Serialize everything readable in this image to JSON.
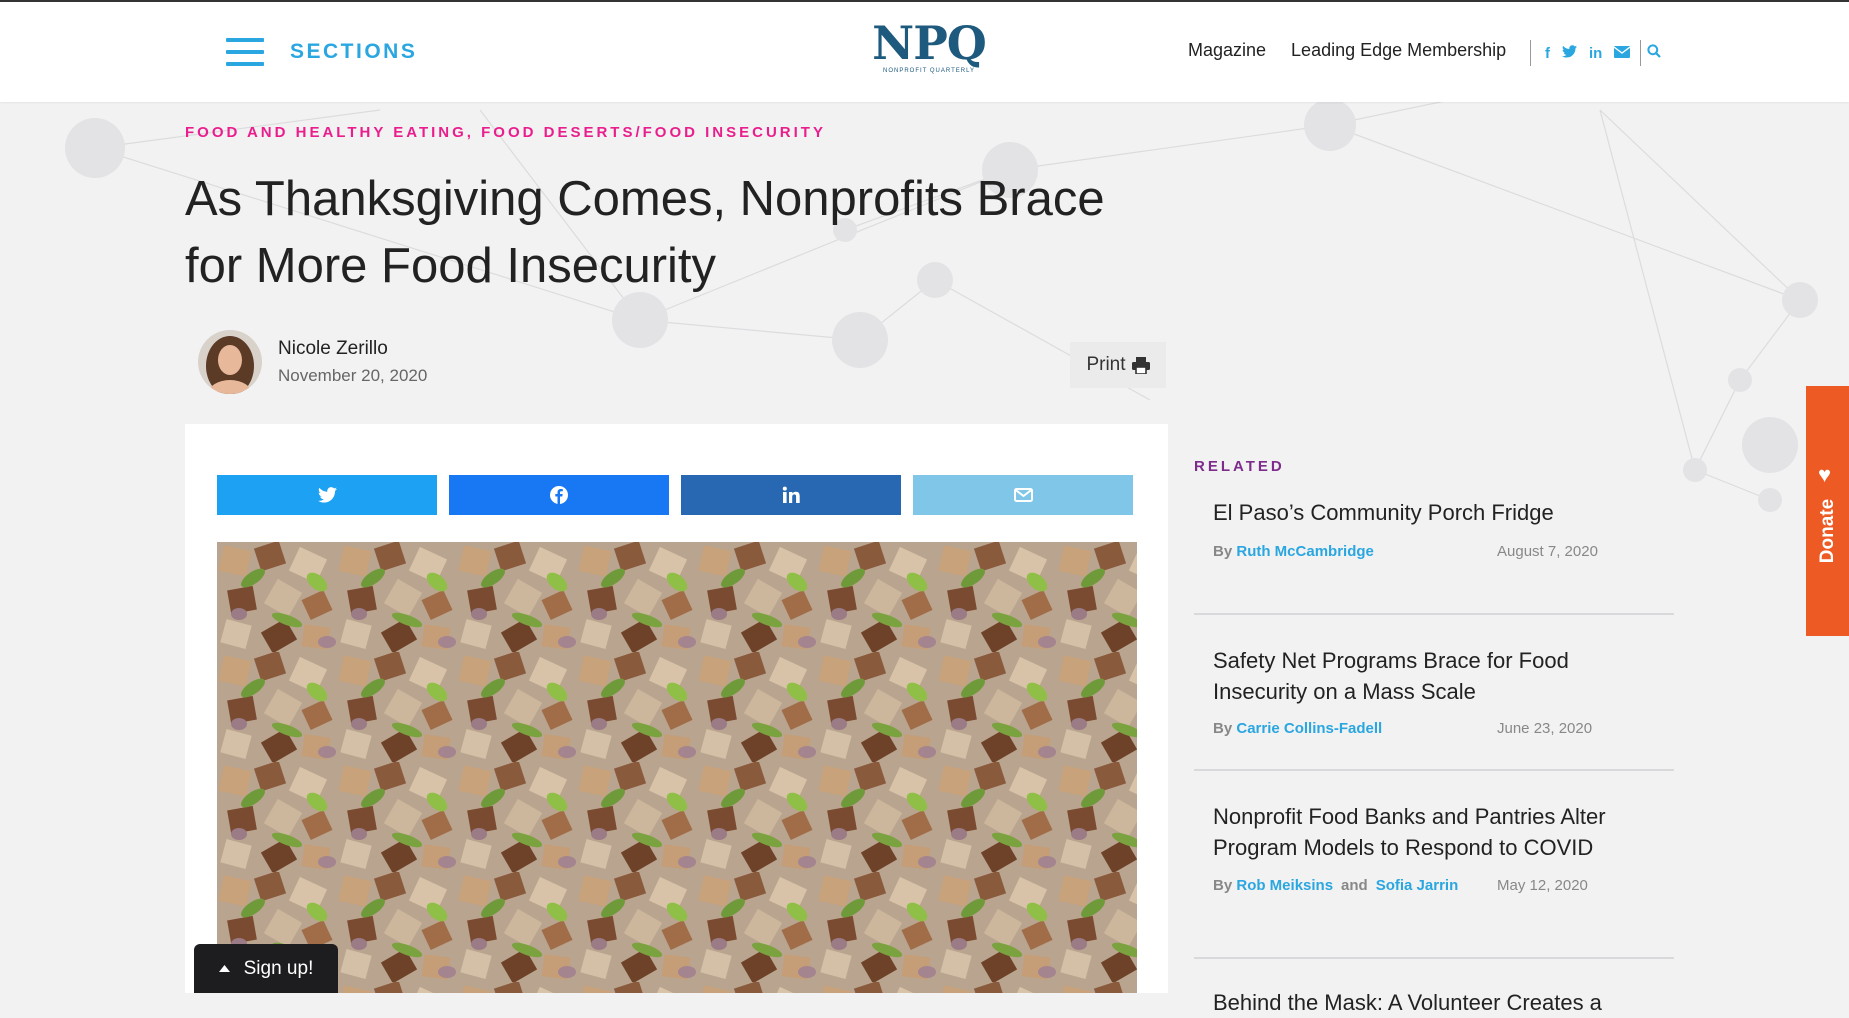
{
  "header": {
    "sections_label": "SECTIONS",
    "logo_text": "NPQ",
    "logo_subtext": "NONPROFIT QUARTERLY",
    "nav": [
      "Magazine",
      "Leading Edge Membership"
    ],
    "social_icons": [
      "facebook-icon",
      "twitter-icon",
      "linkedin-icon",
      "email-icon",
      "search-icon"
    ]
  },
  "article": {
    "category": "FOOD AND HEALTHY EATING, FOOD DESERTS/FOOD INSECURITY",
    "title": "As Thanksgiving Comes, Nonprofits Brace for More Food Insecurity",
    "author": "Nicole Zerillo",
    "date": "November 20, 2020",
    "print_label": "Print"
  },
  "share_buttons": [
    {
      "name": "twitter",
      "icon": "twitter-icon",
      "color": "#1da1f2"
    },
    {
      "name": "facebook",
      "icon": "facebook-icon",
      "color": "#1877f2"
    },
    {
      "name": "linkedin",
      "icon": "linkedin-icon",
      "color": "#2867b2"
    },
    {
      "name": "email",
      "icon": "email-icon",
      "color": "#7fc6e8"
    }
  ],
  "related": {
    "heading": "RELATED",
    "by_label": "By",
    "and_label": "and",
    "items": [
      {
        "title": "El Paso’s Community Porch Fridge",
        "authors": [
          "Ruth McCambridge"
        ],
        "date": "August 7, 2020"
      },
      {
        "title": "Safety Net Programs Brace for Food Insecurity on a Mass Scale",
        "authors": [
          "Carrie Collins-Fadell"
        ],
        "date": "June 23, 2020"
      },
      {
        "title": "Nonprofit Food Banks and Pantries Alter Program Models to Respond to COVID",
        "authors": [
          "Rob Meiksins",
          "Sofia Jarrin"
        ],
        "date": "May 12, 2020"
      },
      {
        "title": "Behind the Mask: A Volunteer Creates a",
        "authors": [],
        "date": ""
      }
    ]
  },
  "signup_label": "Sign up!",
  "donate_label": "Donate",
  "colors": {
    "accent_blue": "#2aa6e0",
    "category_pink": "#e91e8c",
    "related_purple": "#7d2c8c",
    "donate_orange": "#ee5a24",
    "logo_navy": "#1d5a7e"
  }
}
